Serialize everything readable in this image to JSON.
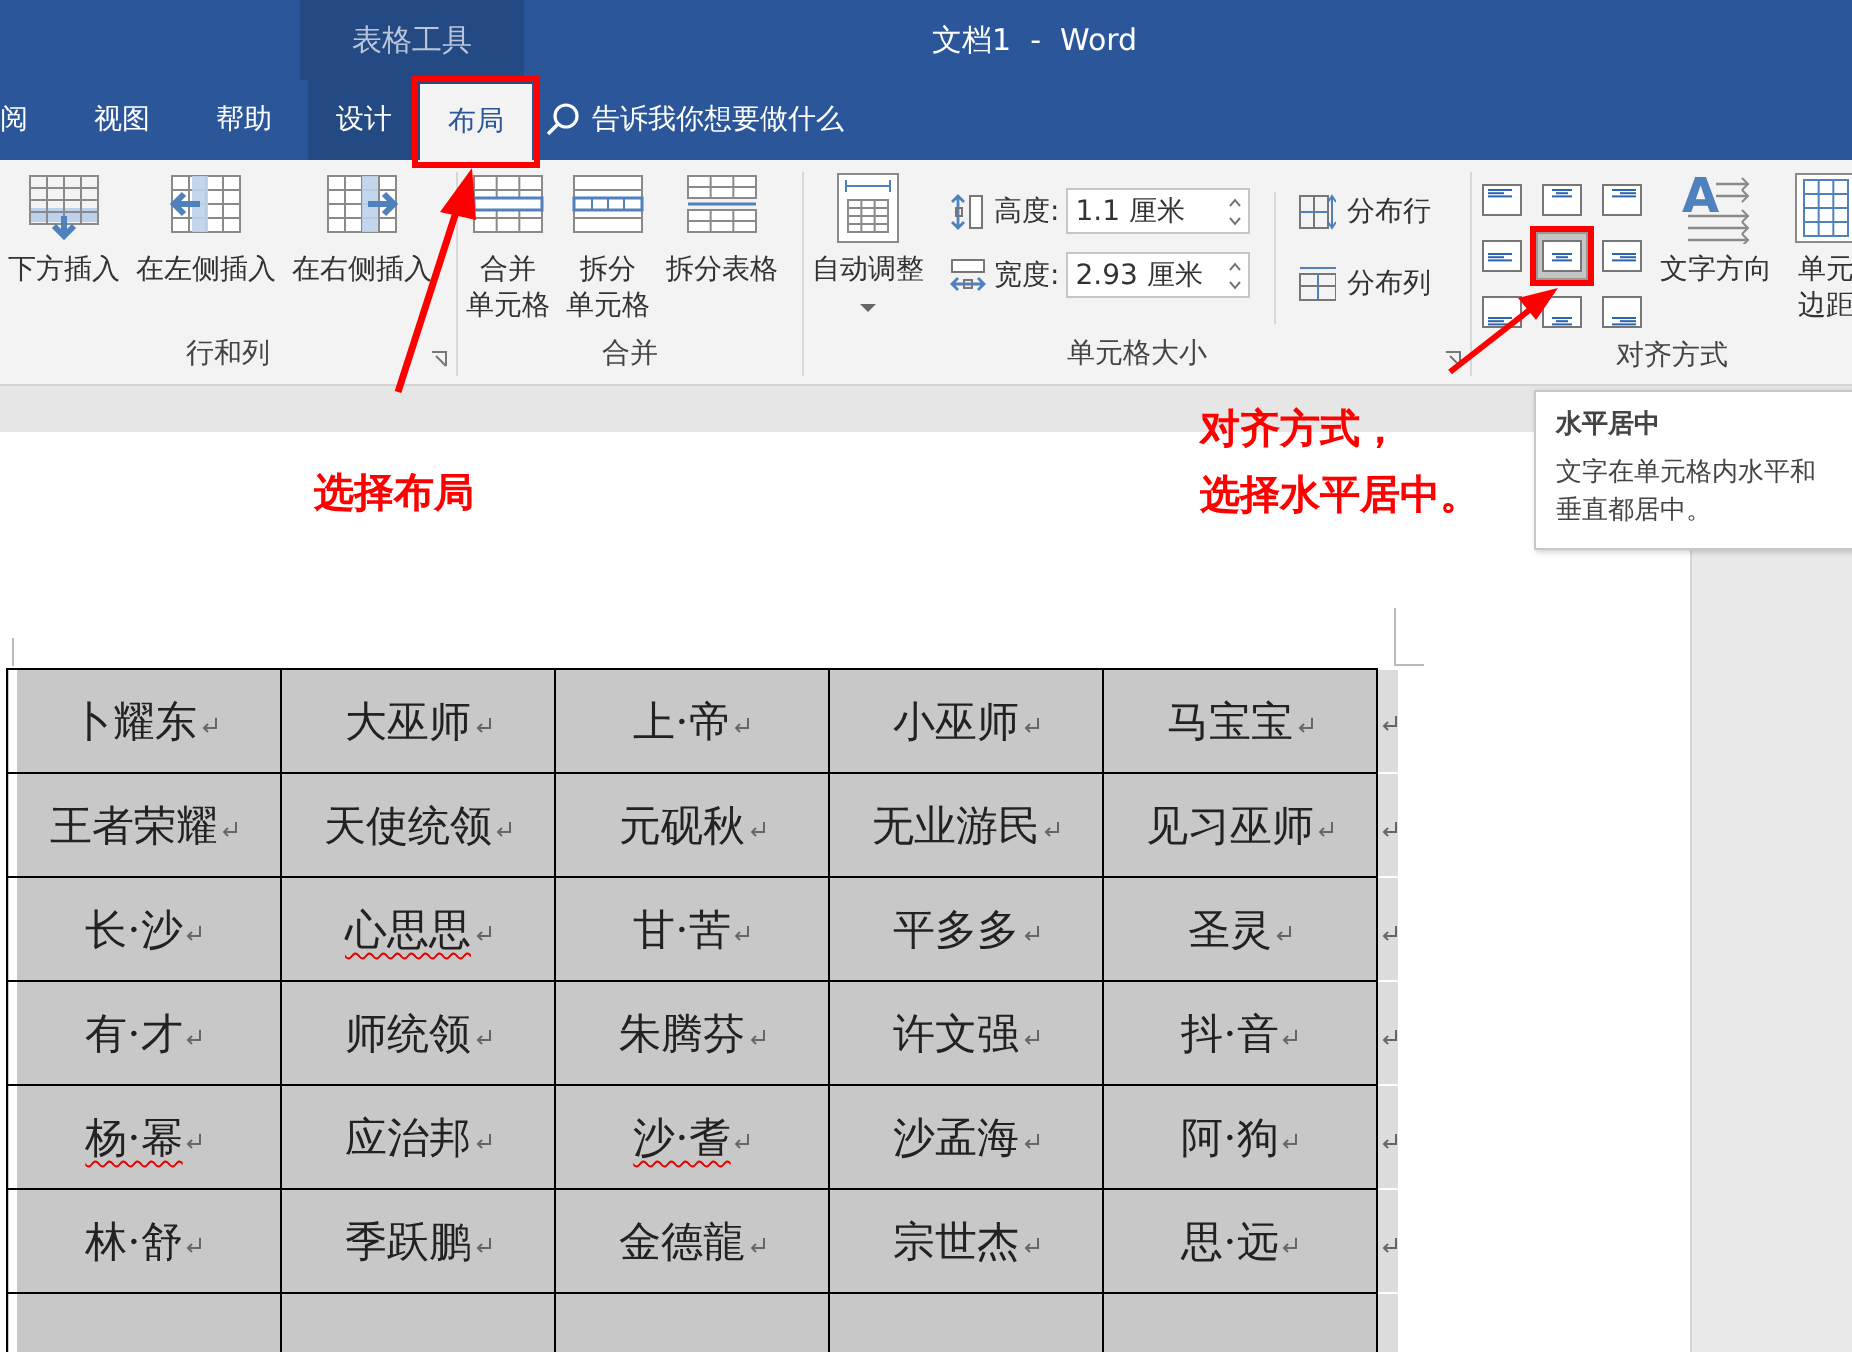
{
  "title_bar": {
    "context_label": "表格工具",
    "title": "文档1  -  Word"
  },
  "tabs": [
    {
      "label": "阅",
      "selected": false,
      "contextual": false
    },
    {
      "label": "视图",
      "selected": false,
      "contextual": false
    },
    {
      "label": "帮助",
      "selected": false,
      "contextual": false
    },
    {
      "label": "设计",
      "selected": false,
      "contextual": true
    },
    {
      "label": "布局",
      "selected": true,
      "contextual": true
    }
  ],
  "tell_me": {
    "placeholder": "告诉我你想要做什么"
  },
  "ribbon": {
    "groups": [
      {
        "name": "行和列",
        "has_launcher": true,
        "items": [
          {
            "kind": "big",
            "lines": [
              "下方插入"
            ]
          },
          {
            "kind": "big",
            "lines": [
              "在左侧插入"
            ]
          },
          {
            "kind": "big",
            "lines": [
              "在右侧插入"
            ]
          }
        ]
      },
      {
        "name": "合并",
        "has_launcher": false,
        "items": [
          {
            "kind": "big",
            "lines": [
              "合并",
              "单元格"
            ]
          },
          {
            "kind": "big",
            "lines": [
              "拆分",
              "单元格"
            ]
          },
          {
            "kind": "big",
            "lines": [
              "拆分表格"
            ]
          }
        ]
      },
      {
        "name": "单元格大小",
        "has_launcher": true,
        "items": [
          {
            "kind": "dropdown",
            "lines": [
              "自动调整"
            ]
          },
          {
            "kind": "fields",
            "fields": [
              {
                "label": "高度:",
                "value": "1.1 厘米"
              },
              {
                "label": "宽度:",
                "value": "2.93 厘米"
              }
            ]
          },
          {
            "kind": "small-stack",
            "buttons": [
              {
                "label": "分布行"
              },
              {
                "label": "分布列"
              }
            ]
          }
        ]
      },
      {
        "name": "对齐方式",
        "has_launcher": false,
        "items": [
          {
            "kind": "align-grid",
            "cells": [
              {
                "selected": false
              },
              {
                "selected": false
              },
              {
                "selected": false
              },
              {
                "selected": false
              },
              {
                "selected": true
              },
              {
                "selected": false
              },
              {
                "selected": false
              },
              {
                "selected": false
              },
              {
                "selected": false
              }
            ]
          },
          {
            "kind": "big",
            "icon_text": "A",
            "lines": [
              "文字方向"
            ]
          },
          {
            "kind": "big",
            "lines": [
              "单元",
              "边距"
            ]
          }
        ]
      }
    ]
  },
  "tooltip": {
    "title": "水平居中",
    "lines": [
      "文字在单元格内水平和",
      "垂直都居中。"
    ]
  },
  "table": {
    "more_rows_below": true,
    "rows": [
      {
        "cells": [
          {
            "text": "卜耀东",
            "spell_error": false
          },
          {
            "text": "大巫师",
            "spell_error": false
          },
          {
            "text": "上·帝",
            "spell_error": false
          },
          {
            "text": "小巫师",
            "spell_error": false
          },
          {
            "text": "马宝宝",
            "spell_error": false
          }
        ]
      },
      {
        "cells": [
          {
            "text": "王者荣耀",
            "spell_error": false
          },
          {
            "text": "天使统领",
            "spell_error": false
          },
          {
            "text": "元砚秋",
            "spell_error": false
          },
          {
            "text": "无业游民",
            "spell_error": false
          },
          {
            "text": "见习巫师",
            "spell_error": false
          }
        ]
      },
      {
        "cells": [
          {
            "text": "长·沙",
            "spell_error": false
          },
          {
            "text": "心思思",
            "spell_error": true
          },
          {
            "text": "甘·苦",
            "spell_error": false
          },
          {
            "text": "平多多",
            "spell_error": false
          },
          {
            "text": "圣灵",
            "spell_error": false
          }
        ]
      },
      {
        "cells": [
          {
            "text": "有·才",
            "spell_error": false
          },
          {
            "text": "师统领",
            "spell_error": false
          },
          {
            "text": "朱腾芬",
            "spell_error": false
          },
          {
            "text": "许文强",
            "spell_error": false
          },
          {
            "text": "抖·音",
            "spell_error": false
          }
        ]
      },
      {
        "cells": [
          {
            "text": "杨·幂",
            "spell_error": true
          },
          {
            "text": "应治邦",
            "spell_error": false
          },
          {
            "text": "沙·耆",
            "spell_error": true
          },
          {
            "text": "沙孟海",
            "spell_error": false
          },
          {
            "text": "阿·狗",
            "spell_error": false
          }
        ]
      },
      {
        "cells": [
          {
            "text": "林·舒",
            "spell_error": false
          },
          {
            "text": "季跃鹏",
            "spell_error": false
          },
          {
            "text": "金德龍",
            "spell_error": false
          },
          {
            "text": "宗世杰",
            "spell_error": false
          },
          {
            "text": "思·远",
            "spell_error": false
          }
        ]
      }
    ]
  },
  "annotations": [
    {
      "lines": [
        "选择布局"
      ]
    },
    {
      "lines": [
        "对齐方式，",
        "选择水平居中。"
      ]
    }
  ]
}
